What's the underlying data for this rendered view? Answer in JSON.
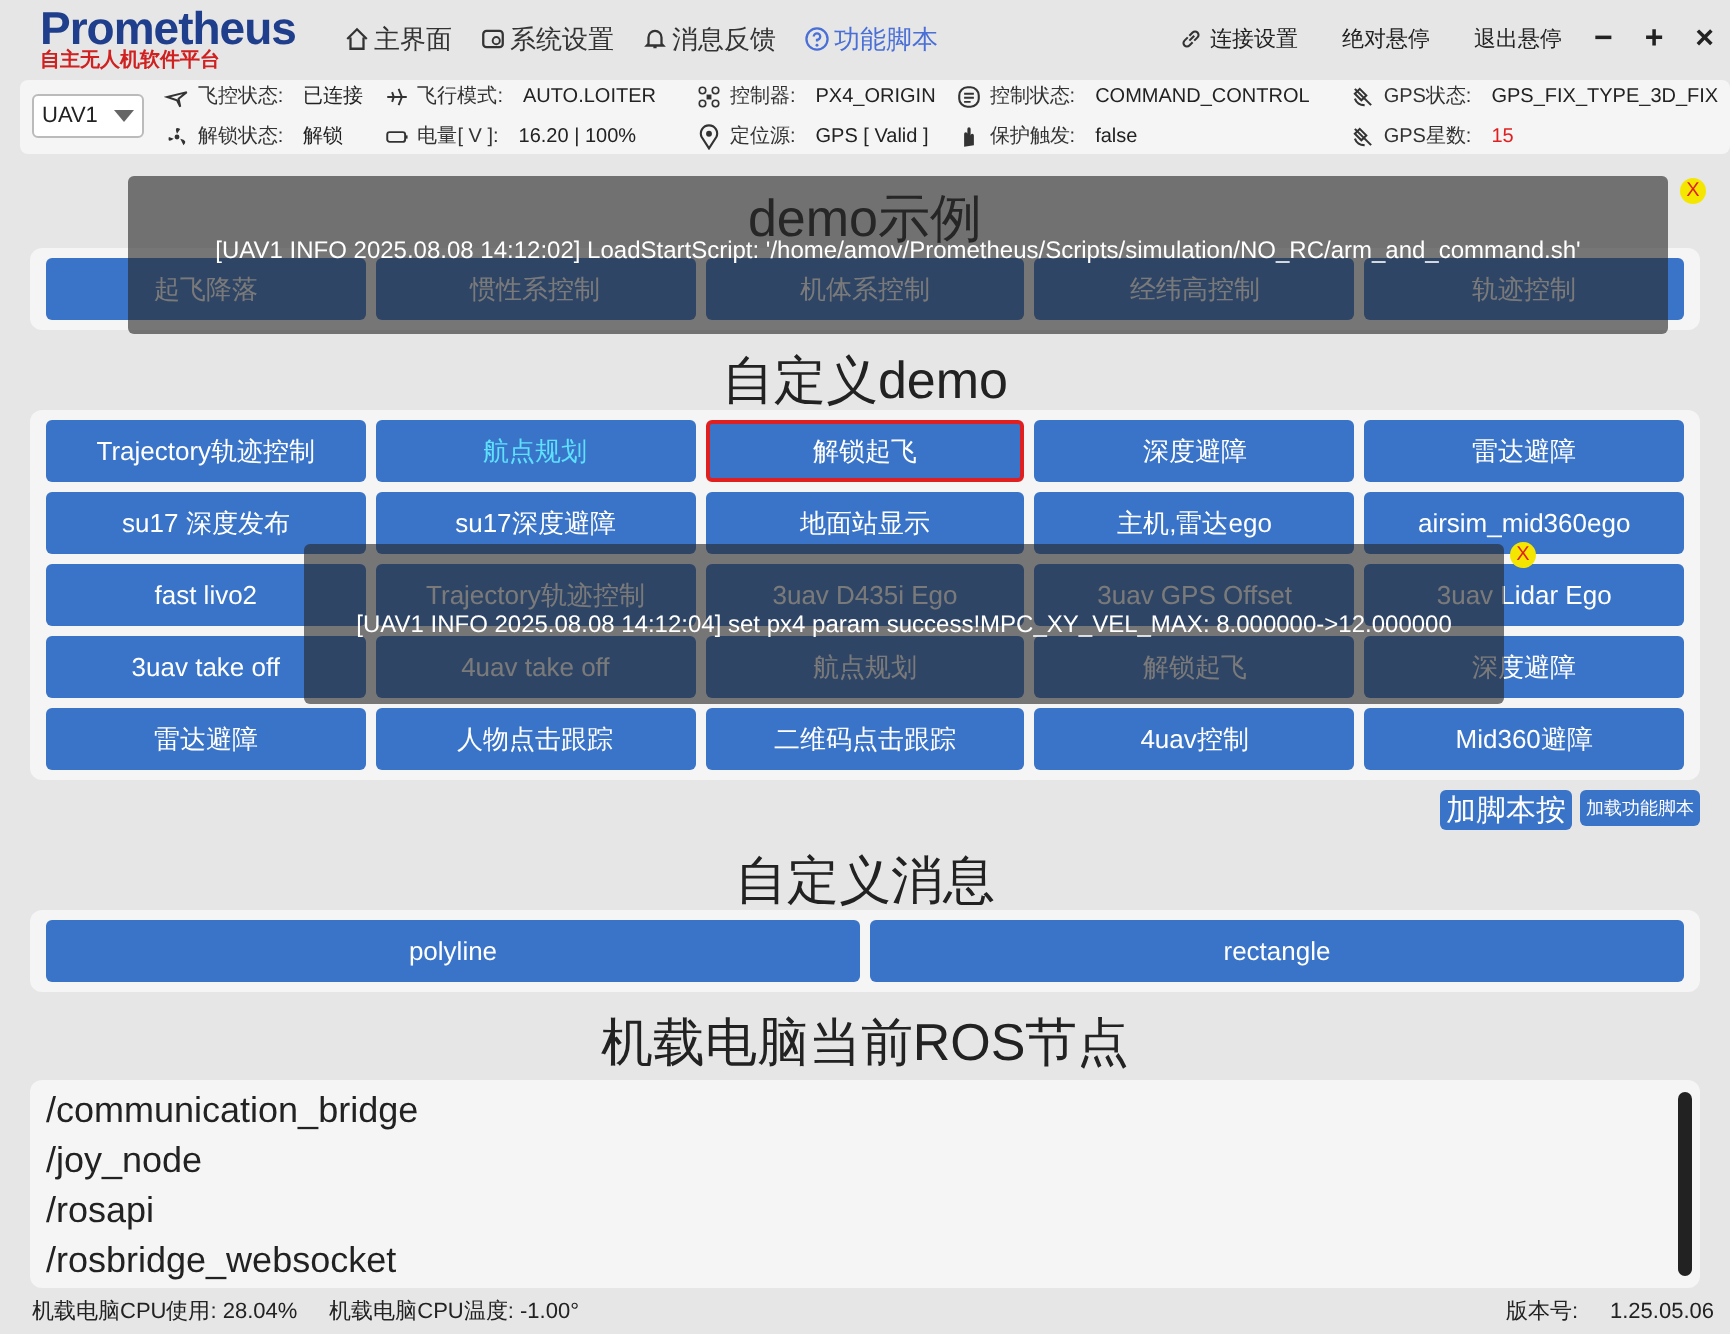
{
  "header": {
    "logo": "Prometheus",
    "logo_subtitle": "自主无人机软件平台",
    "nav": [
      {
        "label": "主界面",
        "selected": false
      },
      {
        "label": "系统设置",
        "selected": false
      },
      {
        "label": "消息反馈",
        "selected": false
      },
      {
        "label": "功能脚本",
        "selected": true
      }
    ],
    "actions": [
      "连接设置",
      "绝对悬停",
      "退出悬停"
    ],
    "window_controls": [
      "−",
      "+",
      "×"
    ]
  },
  "status": {
    "uav_select": "UAV1",
    "groups": [
      [
        {
          "label": "飞控状态:",
          "value": "已连接"
        },
        {
          "label": "解锁状态:",
          "value": "解锁"
        }
      ],
      [
        {
          "label": "飞行模式:",
          "value": "AUTO.LOITER"
        },
        {
          "label": "电量[ V ]:",
          "value": "16.20 | 100%"
        }
      ],
      [
        {
          "label": "控制器:",
          "value": "PX4_ORIGIN"
        },
        {
          "label": "定位源:",
          "value": "GPS [ Valid ]"
        }
      ],
      [
        {
          "label": "控制状态:",
          "value": "COMMAND_CONTROL"
        },
        {
          "label": "保护触发:",
          "value": "false"
        }
      ],
      [
        {
          "label": "GPS状态:",
          "value": "GPS_FIX_TYPE_3D_FIX",
          "alert": false
        },
        {
          "label": "GPS星数:",
          "value": "15",
          "alert": true
        }
      ]
    ]
  },
  "sections": [
    {
      "kind": "buttons",
      "title": "demo示例",
      "buttons": [
        {
          "label": "起飞降落"
        },
        {
          "label": "惯性系控制"
        },
        {
          "label": "机体系控制"
        },
        {
          "label": "经纬高控制"
        },
        {
          "label": "轨迹控制"
        }
      ]
    },
    {
      "kind": "buttons",
      "title": "自定义demo",
      "buttons": [
        {
          "label": "Trajectory轨迹控制"
        },
        {
          "label": "航点规划",
          "highlighted": true
        },
        {
          "label": "解锁起飞",
          "outlined": true
        },
        {
          "label": "深度避障"
        },
        {
          "label": "雷达避障"
        },
        {
          "label": "su17 深度发布"
        },
        {
          "label": "su17深度避障"
        },
        {
          "label": "地面站显示"
        },
        {
          "label": "主机,雷达ego"
        },
        {
          "label": "airsim_mid360ego"
        },
        {
          "label": "fast livo2"
        },
        {
          "label": "Trajectory轨迹控制"
        },
        {
          "label": "3uav D435i Ego"
        },
        {
          "label": "3uav GPS Offset"
        },
        {
          "label": "3uav Lidar Ego"
        },
        {
          "label": "3uav take off"
        },
        {
          "label": "4uav take off"
        },
        {
          "label": "航点规划"
        },
        {
          "label": "解锁起飞"
        },
        {
          "label": "深度避障"
        },
        {
          "label": "雷达避障"
        },
        {
          "label": "人物点击跟踪"
        },
        {
          "label": "二维码点击跟踪"
        },
        {
          "label": "4uav控制"
        },
        {
          "label": "Mid360避障"
        }
      ],
      "tools": [
        "加脚本按",
        "加载功能脚本"
      ]
    },
    {
      "kind": "buttons",
      "title": "自定义消息",
      "buttons": [
        {
          "label": "polyline"
        },
        {
          "label": "rectangle"
        }
      ]
    },
    {
      "kind": "list",
      "title": "机载电脑当前ROS节点",
      "items": [
        "/communication_bridge",
        "/joy_node",
        "/rosapi",
        "/rosbridge_websocket"
      ]
    }
  ],
  "toasts": [
    {
      "message": "[UAV1 INFO 2025.08.08 14:12:02] LoadStartScript: '/home/amov/Prometheus/Scripts/simulation/NO_RC/arm_and_command.sh'",
      "close": "X"
    },
    {
      "message": "[UAV1 INFO 2025.08.08 14:12:04] set px4 param success!MPC_XY_VEL_MAX: 8.000000->12.000000",
      "close": "X"
    }
  ],
  "footer": {
    "cpu_usage": "机载电脑CPU使用: 28.04%",
    "cpu_temp": "机载电脑CPU温度: -1.00°",
    "version_label": "版本号:",
    "version": "1.25.05.06"
  }
}
